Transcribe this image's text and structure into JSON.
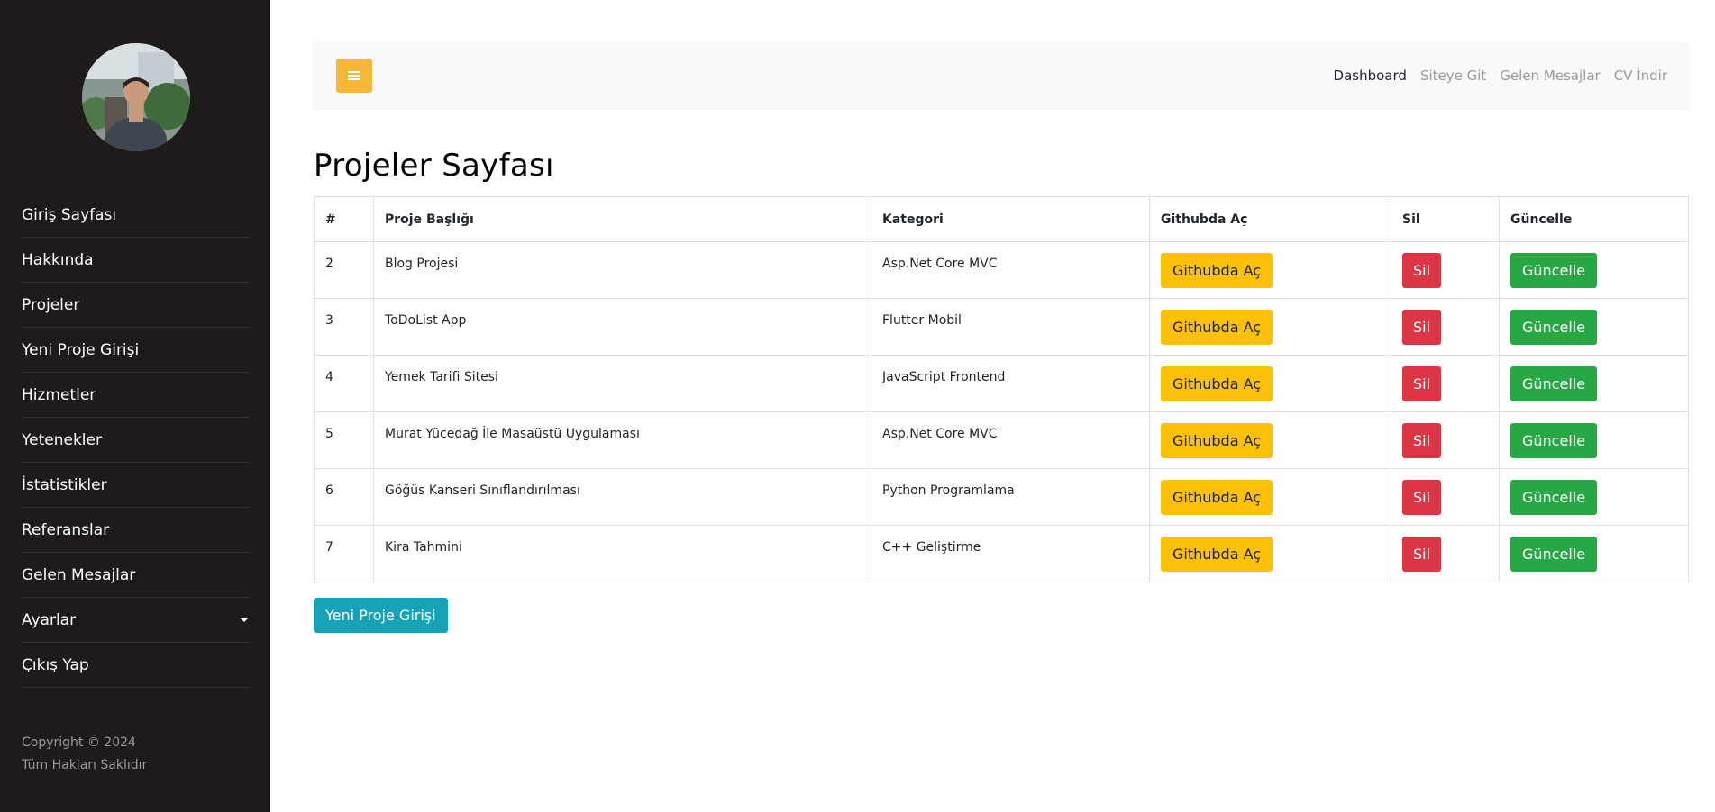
{
  "sidebar": {
    "items": [
      {
        "label": "Giriş Sayfası"
      },
      {
        "label": "Hakkında"
      },
      {
        "label": "Projeler"
      },
      {
        "label": "Yeni Proje Girişi"
      },
      {
        "label": "Hizmetler"
      },
      {
        "label": "Yetenekler"
      },
      {
        "label": "İstatistikler"
      },
      {
        "label": "Referanslar"
      },
      {
        "label": "Gelen Mesajlar"
      },
      {
        "label": "Ayarlar"
      },
      {
        "label": "Çıkış Yap"
      }
    ],
    "footer": {
      "line1": "Copyright © 2024",
      "line2": "Tüm Hakları Saklıdır"
    }
  },
  "topbar": {
    "toggle_icon": "hamburger-icon",
    "links": [
      "Dashboard",
      "Siteye Git",
      "Gelen Mesajlar",
      "CV İndir"
    ],
    "active_link": "Dashboard"
  },
  "page": {
    "title": "Projeler Sayfası"
  },
  "table": {
    "headers": [
      "#",
      "Proje Başlığı",
      "Kategori",
      "Githubda Aç",
      "Sil",
      "Güncelle"
    ],
    "rows": [
      {
        "id": "2",
        "title": "Blog Projesi",
        "category": "Asp.Net Core MVC"
      },
      {
        "id": "3",
        "title": "ToDoList App",
        "category": "Flutter Mobil"
      },
      {
        "id": "4",
        "title": "Yemek Tarifi Sitesi",
        "category": "JavaScript Frontend"
      },
      {
        "id": "5",
        "title": "Murat Yücedağ İle Masaüstü Uygulaması",
        "category": "Asp.Net Core MVC"
      },
      {
        "id": "6",
        "title": "Göğüs Kanseri Sınıflandırılması",
        "category": "Python Programlama"
      },
      {
        "id": "7",
        "title": "Kira Tahmini",
        "category": "C++ Geliştirme"
      }
    ],
    "github_label": "Githubda Aç",
    "delete_label": "Sil",
    "update_label": "Güncelle"
  },
  "new_project_button": "Yeni Proje Girişi",
  "colors": {
    "sidebar_bg": "#1e1b1a",
    "toggle": "#f8b739",
    "warning": "#ffc107",
    "danger": "#dc3545",
    "success": "#28a745",
    "info": "#17a2b8"
  }
}
